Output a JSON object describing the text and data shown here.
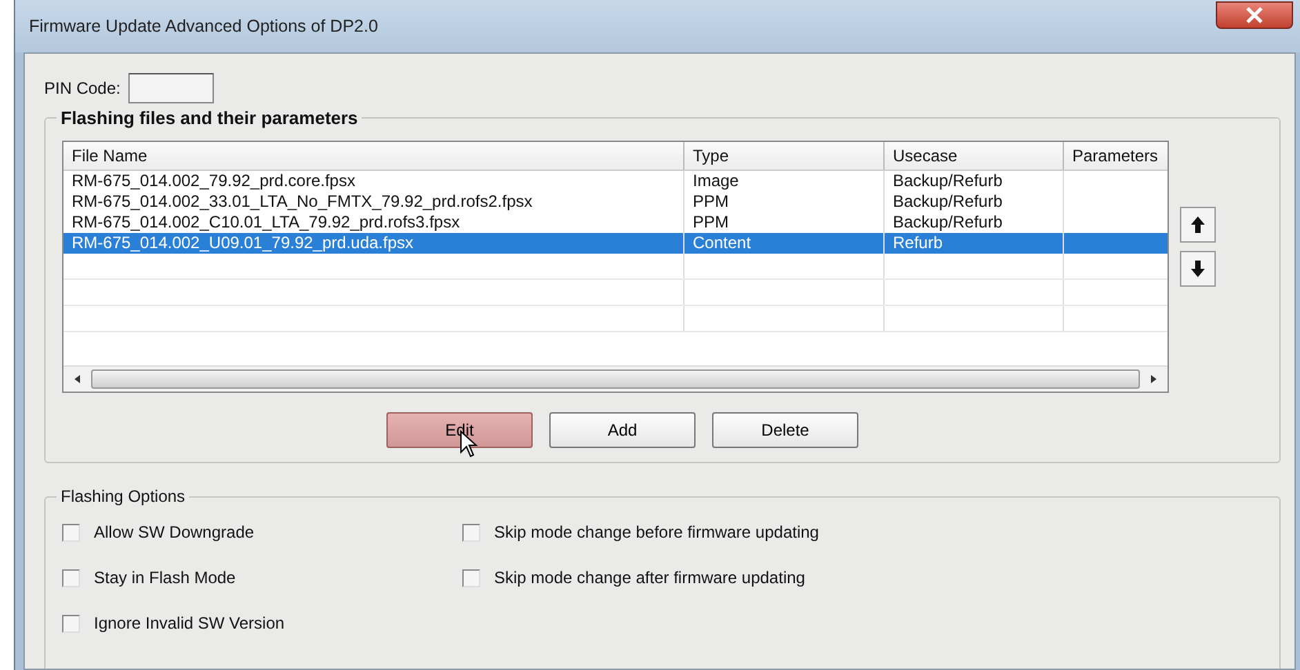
{
  "window": {
    "title": "Firmware Update Advanced Options of DP2.0"
  },
  "pin_code": {
    "label": "PIN Code:"
  },
  "files_group": {
    "title": "Flashing files and their parameters",
    "table": {
      "columns": [
        "File Name",
        "Type",
        "Usecase",
        "Parameters"
      ],
      "rows": [
        {
          "cells": [
            "RM-675_014.002_79.92_prd.core.fpsx",
            "Image",
            "Backup/Refurb",
            ""
          ],
          "selected": false
        },
        {
          "cells": [
            "RM-675_014.002_33.01_LTA_No_FMTX_79.92_prd.rofs2.fpsx",
            "PPM",
            "Backup/Refurb",
            ""
          ],
          "selected": false
        },
        {
          "cells": [
            "RM-675_014.002_C10.01_LTA_79.92_prd.rofs3.fpsx",
            "PPM",
            "Backup/Refurb",
            ""
          ],
          "selected": false
        },
        {
          "cells": [
            "RM-675_014.002_U09.01_79.92_prd.uda.fpsx",
            "Content",
            "Refurb",
            ""
          ],
          "selected": true
        }
      ]
    },
    "buttons": [
      {
        "label": "Edit",
        "hovered": true
      },
      {
        "label": "Add",
        "hovered": false
      },
      {
        "label": "Delete",
        "hovered": false
      }
    ]
  },
  "options_group": {
    "title": "Flashing Options",
    "options": [
      {
        "label": "Allow SW Downgrade",
        "checked": false
      },
      {
        "label": "Skip mode change before firmware updating",
        "checked": false
      },
      {
        "label": "Stay in Flash Mode",
        "checked": false
      },
      {
        "label": "Skip mode change after firmware updating",
        "checked": false
      },
      {
        "label": "Ignore Invalid SW Version",
        "checked": false
      }
    ]
  }
}
